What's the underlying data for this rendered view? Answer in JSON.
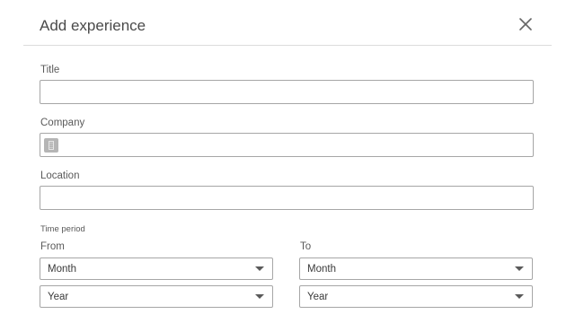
{
  "modal": {
    "title": "Add experience",
    "close_icon": "close-icon"
  },
  "form": {
    "title_label": "Title",
    "title_value": "",
    "company_label": "Company",
    "company_value": "",
    "company_icon": "building-icon",
    "location_label": "Location",
    "location_value": "",
    "time_period_label": "Time period",
    "from_label": "From",
    "to_label": "To",
    "from_month": "Month",
    "from_year": "Year",
    "to_month": "Month",
    "to_year": "Year"
  }
}
